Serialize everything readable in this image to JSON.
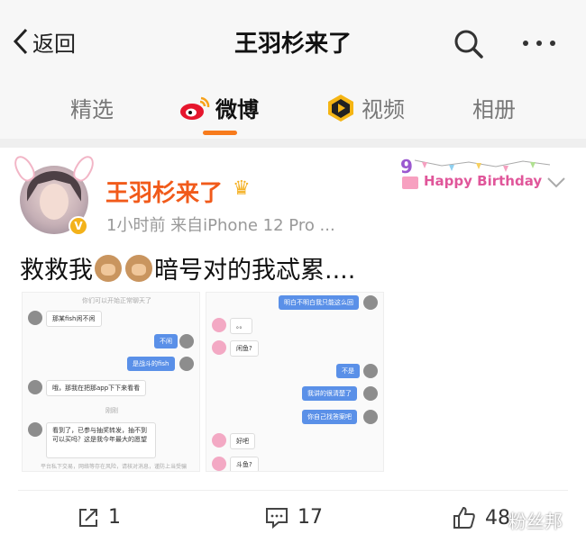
{
  "header": {
    "back_label": "返回",
    "title": "王羽杉来了"
  },
  "tabs": [
    {
      "label": "精选"
    },
    {
      "label": "微博",
      "active": true
    },
    {
      "label": "视频"
    },
    {
      "label": "相册"
    }
  ],
  "post": {
    "username": "王羽杉来了",
    "meta": "1小时前  来自iPhone 12 Pro ...",
    "text_a": "救救我",
    "text_b": "暗号对的我忒累....",
    "badge_text": "Happy Birthday",
    "image1": {
      "top_note": "你们可以开始正常聊天了",
      "msg1": "那某fish闲不闲",
      "msg2": "不闲",
      "msg3": "是战斗的fish",
      "msg4": "哦，那我在把那app下下来看看",
      "system": "刚刚",
      "msg5": "看到了，已参与抽奖转发，抽不到可以买吗？这是我今年最大的愿望",
      "footer_note": "平台私下交易，网络等存在风险，请核对消息，谨防上当受骗"
    },
    "image2": {
      "msg1": "明白不明白我只能这么回",
      "msg2": "。。",
      "msg3": "闲鱼?",
      "msg4": "不是",
      "msg5": "我讲的很清楚了",
      "msg6": "你自己找答案吧",
      "msg7": "好吧",
      "msg8": "斗鱼?"
    }
  },
  "actions": {
    "repost_count": "1",
    "comment_count": "17",
    "like_count": "48"
  },
  "watermark": "粉丝邦",
  "colors": {
    "accent": "#f77b1c",
    "username": "#f15a1a",
    "chat_blue": "#5a90e8"
  }
}
